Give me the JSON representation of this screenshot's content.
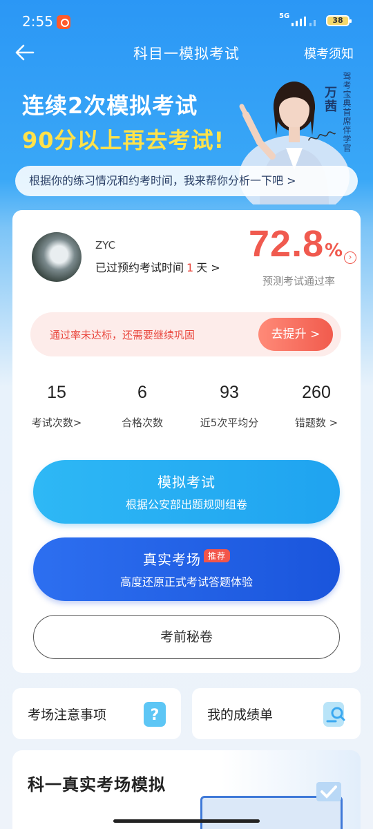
{
  "status_bar": {
    "time": "2:55",
    "network": "5G",
    "battery": "38"
  },
  "nav": {
    "title": "科目一模拟考试",
    "right_label": "模考须知"
  },
  "banner": {
    "line1": "连续2次模拟考试",
    "line2": "90分以上再去考试!",
    "mentor_name": "万茜",
    "mentor_title": "驾考宝典首席伴学官",
    "analysis_text": "根据你的练习情况和约考时间，我来帮你分析一下吧 >"
  },
  "user": {
    "name": "ZYC",
    "booked_prefix": "已过预约考试时间",
    "booked_days": "1",
    "booked_suffix": "天 >"
  },
  "pass_rate": {
    "value": "72.8",
    "unit": "%",
    "label": "预测考试通过率"
  },
  "warning": {
    "text": "通过率未达标，还需要继续巩固",
    "button": "去提升 >"
  },
  "stats": [
    {
      "value": "15",
      "label": "考试次数>"
    },
    {
      "value": "6",
      "label": "合格次数"
    },
    {
      "value": "93",
      "label": "近5次平均分"
    },
    {
      "value": "260",
      "label": "错题数 >"
    }
  ],
  "actions": {
    "mock": {
      "title": "模拟考试",
      "subtitle": "根据公安部出题规则组卷"
    },
    "real": {
      "title": "真实考场",
      "tag": "推荐",
      "subtitle": "高度还原正式考试答题体验"
    },
    "secret": {
      "title": "考前秘卷"
    }
  },
  "mini_cards": [
    {
      "label": "考场注意事项",
      "icon": "question-doc-icon"
    },
    {
      "label": "我的成绩单",
      "icon": "search-doc-icon"
    }
  ],
  "bottom_section": {
    "title": "科一真实考场模拟"
  },
  "colors": {
    "accent_blue": "#2b97f5",
    "rate_red": "#f05a4f",
    "banner_yellow": "#ffe24a"
  }
}
